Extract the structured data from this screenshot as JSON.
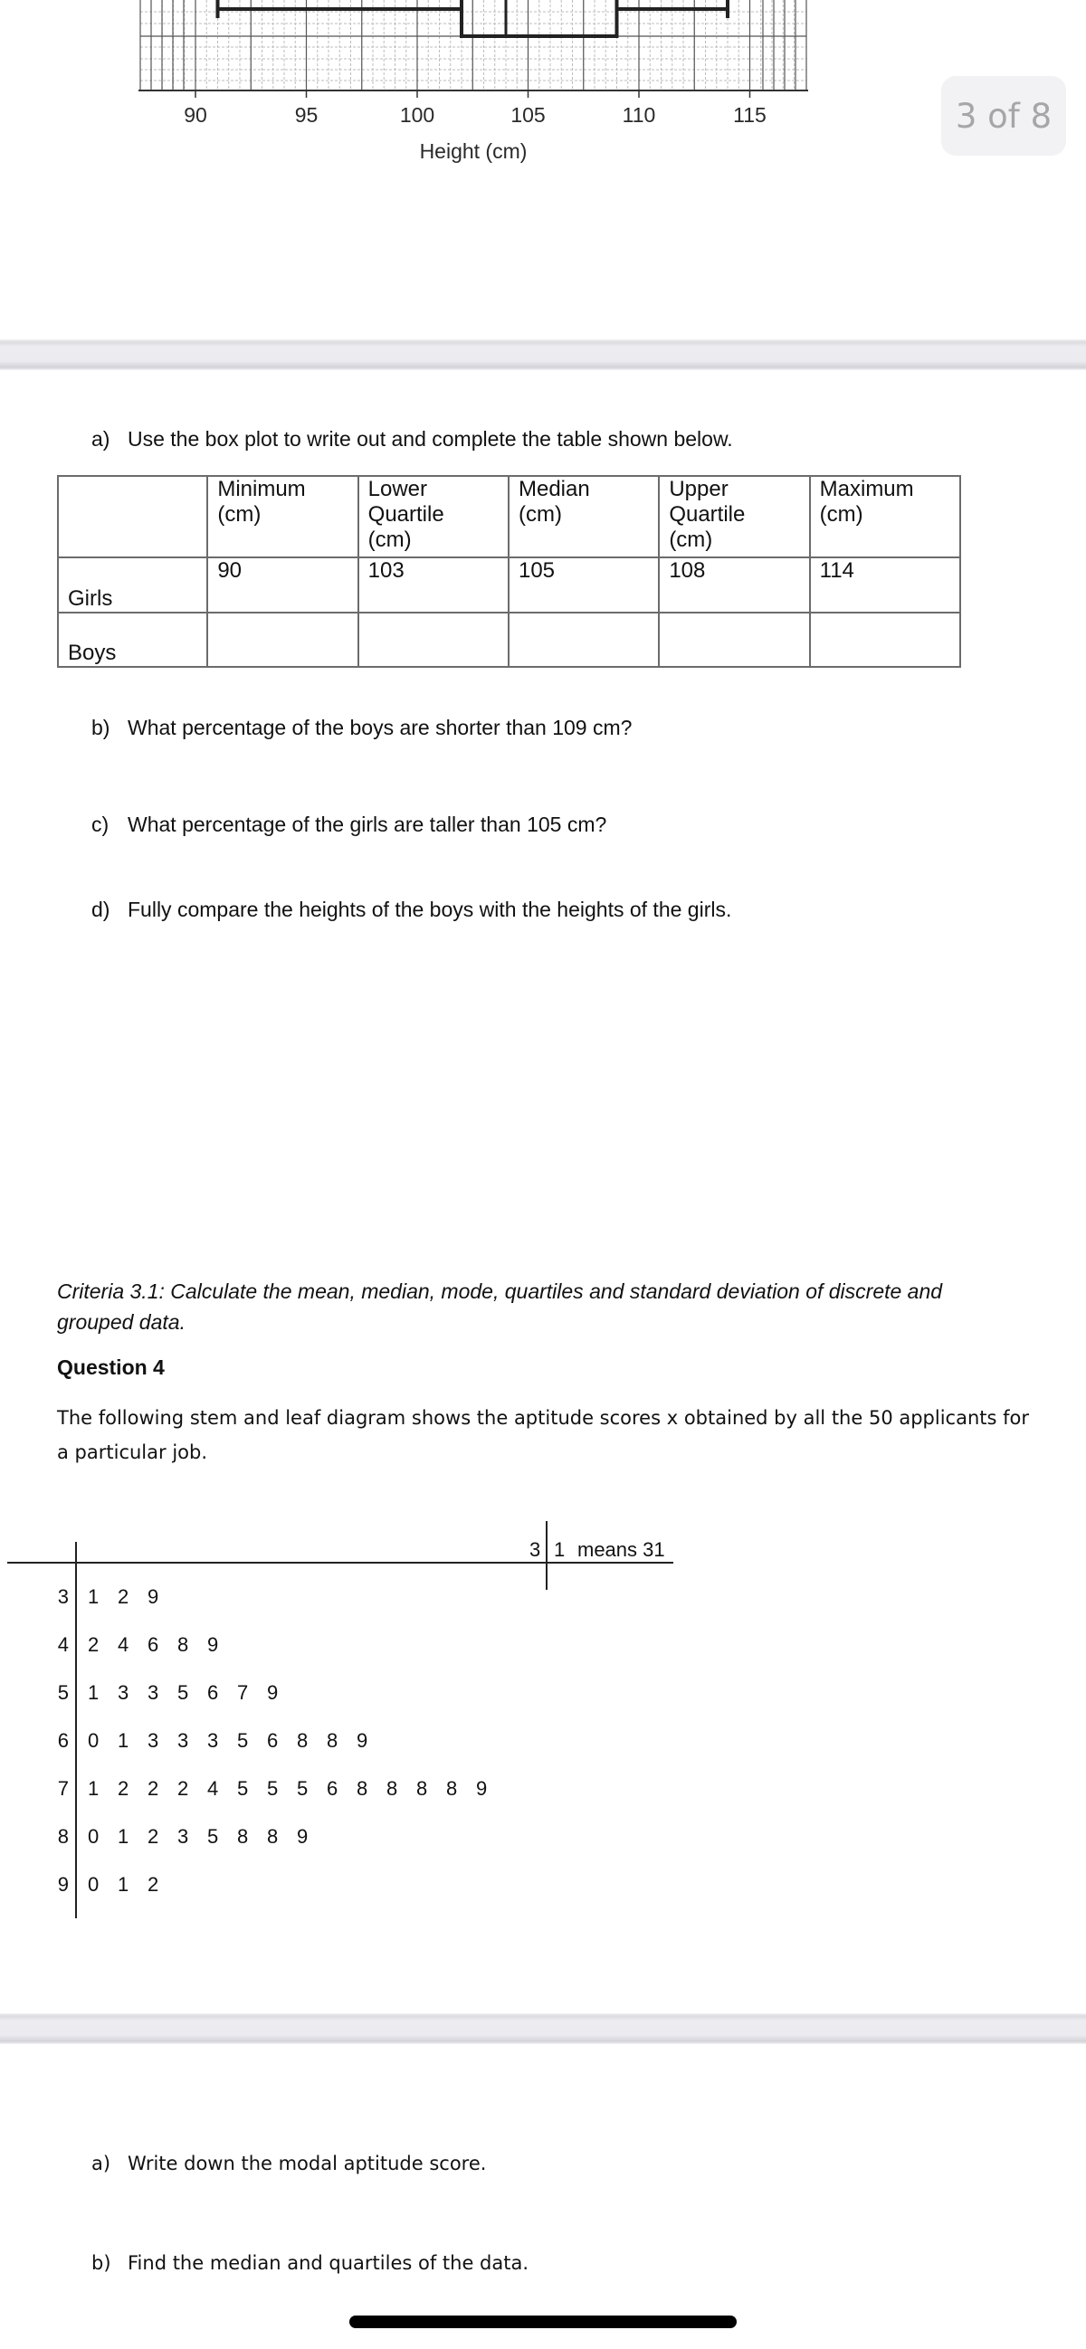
{
  "page_indicator": {
    "current": 3,
    "total": 8,
    "label": "3 of 8"
  },
  "chart_data": {
    "type": "boxplot",
    "title": "",
    "xlabel": "Height (cm)",
    "x_ticks": [
      90,
      95,
      100,
      105,
      110,
      115
    ],
    "x_tick_labels": [
      "90",
      "95",
      "100",
      "105",
      "110",
      "115"
    ],
    "xlim": [
      88,
      117
    ],
    "grid": true,
    "visible_box": {
      "min": 91,
      "lower_quartile": 102,
      "median": 104,
      "upper_quartile": 109,
      "max": 114
    }
  },
  "question3": {
    "a": {
      "label": "a)",
      "text": "Use the box plot to write out and complete the table shown below."
    },
    "table": {
      "headers": [
        "",
        "Minimum (cm)",
        "Lower Quartile (cm)",
        "Median (cm)",
        "Upper Quartile (cm)",
        "Maximum (cm)"
      ],
      "header_lines": [
        [
          ""
        ],
        [
          "Minimum",
          "(cm)"
        ],
        [
          "Lower",
          "Quartile",
          "(cm)"
        ],
        [
          "Median",
          "(cm)"
        ],
        [
          "Upper",
          "Quartile",
          "(cm)"
        ],
        [
          "Maximum",
          "(cm)"
        ]
      ],
      "rows": [
        {
          "label": "Girls",
          "values": [
            "90",
            "103",
            "105",
            "108",
            "114"
          ]
        },
        {
          "label": "Boys",
          "values": [
            "",
            "",
            "",
            "",
            ""
          ]
        }
      ]
    },
    "b": {
      "label": "b)",
      "text": "What percentage of the boys are shorter than 109 cm?"
    },
    "c": {
      "label": "c)",
      "text": "What percentage of the girls are taller than 105 cm?"
    },
    "d": {
      "label": "d)",
      "text": "Fully compare the heights of the boys with the heights of the girls."
    }
  },
  "criteria": "Criteria 3.1:  Calculate the mean, median, mode, quartiles and standard deviation of discrete and grouped data.",
  "question4": {
    "heading": "Question 4",
    "intro": "The following stem and leaf diagram shows the aptitude scores x obtained by all the 50 applicants for a particular job.",
    "key": {
      "stem": "3",
      "leaf": "1",
      "text": "means 31"
    },
    "stem_leaf": [
      {
        "stem": "3",
        "leaves": [
          "1",
          "2",
          "9"
        ]
      },
      {
        "stem": "4",
        "leaves": [
          "2",
          "4",
          "6",
          "8",
          "9"
        ]
      },
      {
        "stem": "5",
        "leaves": [
          "1",
          "3",
          "3",
          "5",
          "6",
          "7",
          "9"
        ]
      },
      {
        "stem": "6",
        "leaves": [
          "0",
          "1",
          "3",
          "3",
          "3",
          "5",
          "6",
          "8",
          "8",
          "9"
        ]
      },
      {
        "stem": "7",
        "leaves": [
          "1",
          "2",
          "2",
          "2",
          "4",
          "5",
          "5",
          "5",
          "6",
          "8",
          "8",
          "8",
          "8",
          "9"
        ]
      },
      {
        "stem": "8",
        "leaves": [
          "0",
          "1",
          "2",
          "3",
          "5",
          "8",
          "8",
          "9"
        ]
      },
      {
        "stem": "9",
        "leaves": [
          "0",
          "1",
          "2"
        ]
      }
    ],
    "a": {
      "label": "a)",
      "text": "Write down the modal aptitude score."
    },
    "b": {
      "label": "b)",
      "text": "Find the median and quartiles of the data."
    }
  }
}
